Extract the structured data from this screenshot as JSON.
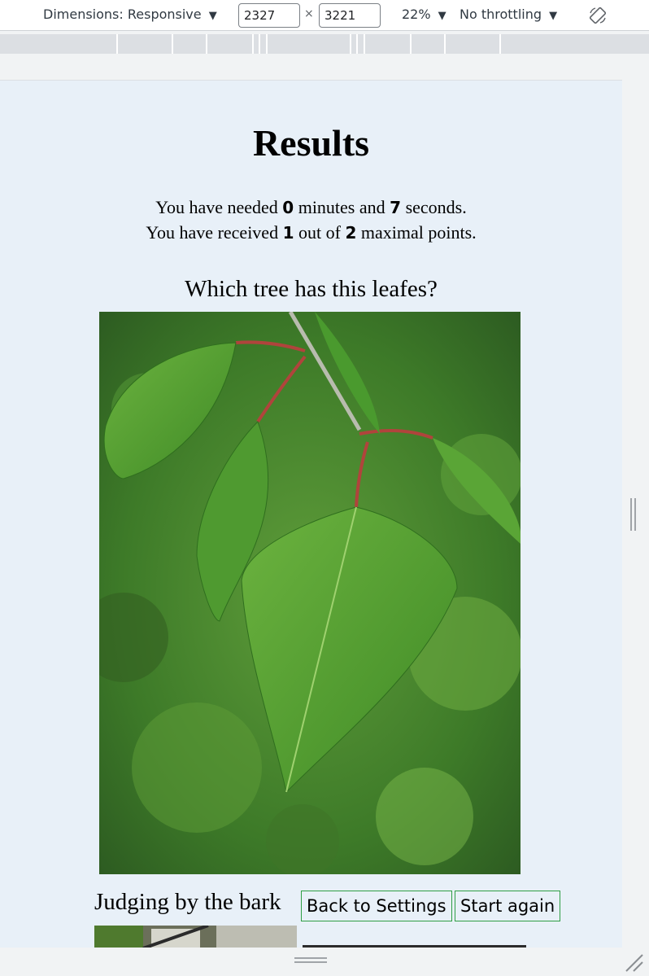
{
  "devtools": {
    "dimensions_label": "Dimensions: Responsive",
    "width_value": "2327",
    "times_sign": "×",
    "height_value": "3221",
    "zoom_label": "22%",
    "throttling_label": "No throttling",
    "dropdown_arrow": "▼",
    "rotate_icon": "rotate-icon"
  },
  "page": {
    "title": "Results",
    "line1_prefix": "You have needed ",
    "minutes": "0",
    "line1_mid": " minutes and ",
    "seconds": "7",
    "line1_suffix": " seconds.",
    "line2_prefix": "You have received ",
    "points": "1",
    "line2_mid": " out of ",
    "max_points": "2",
    "line2_suffix": " maximal points.",
    "question": "Which tree has this leafes?",
    "bark_label": "Judging by the bark",
    "back_button": "Back to Settings",
    "restart_button": "Start again"
  },
  "colors": {
    "page_background": "#e8f0f8",
    "button_border": "#2f9e44"
  }
}
